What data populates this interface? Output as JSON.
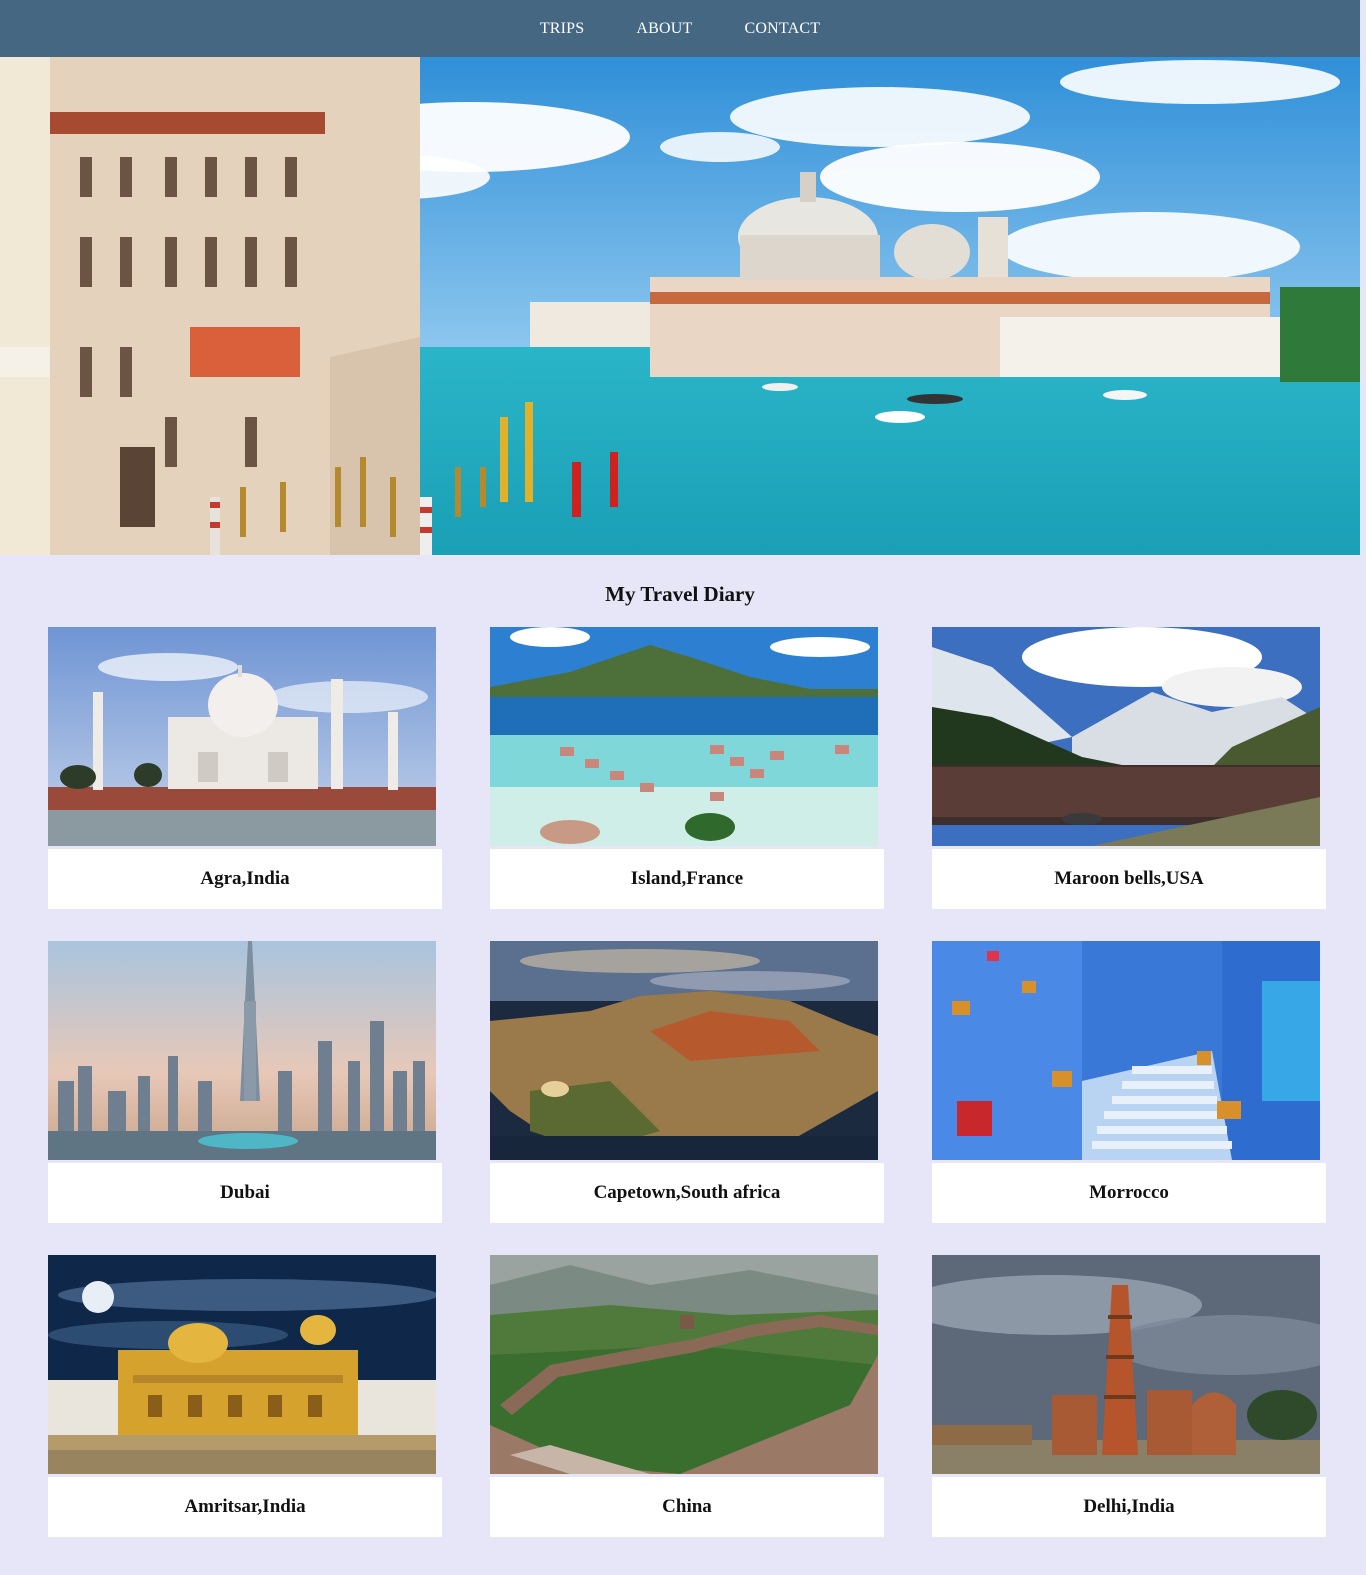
{
  "nav": {
    "items": [
      {
        "label": "TRIPS"
      },
      {
        "label": "ABOUT"
      },
      {
        "label": "CONTACT"
      }
    ]
  },
  "hero": {
    "image": "venice-grand-canal-photo"
  },
  "main": {
    "title": "My Travel Diary",
    "cards": [
      {
        "caption": "Agra,India",
        "image": "taj-mahal-photo"
      },
      {
        "caption": "Island,France",
        "image": "tropical-island-bungalows-photo"
      },
      {
        "caption": "Maroon bells,USA",
        "image": "mountain-lake-photo"
      },
      {
        "caption": "Dubai",
        "image": "dubai-skyline-photo"
      },
      {
        "caption": "Capetown,South africa",
        "image": "cape-town-aerial-photo"
      },
      {
        "caption": "Morrocco",
        "image": "blue-city-street-photo"
      },
      {
        "caption": "Amritsar,India",
        "image": "golden-temple-photo"
      },
      {
        "caption": "China",
        "image": "great-wall-photo"
      },
      {
        "caption": "Delhi,India",
        "image": "qutub-minar-photo"
      }
    ]
  },
  "colors": {
    "nav_bg": "#456782",
    "page_bg": "#e6e6f8",
    "caption_bg": "#ffffff"
  }
}
